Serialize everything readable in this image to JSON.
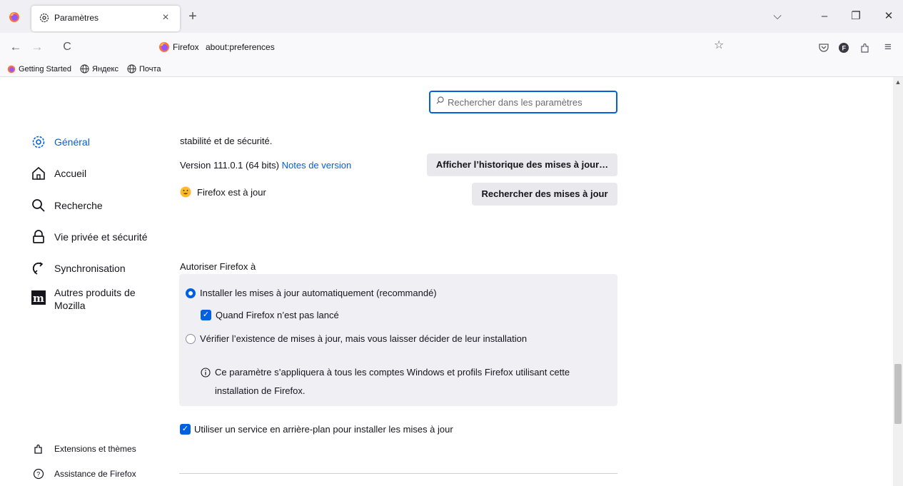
{
  "tab": {
    "title": "Paramètres",
    "close": "×",
    "new": "+"
  },
  "window": {
    "list_tabs": "⌵",
    "minimize": "–",
    "restore": "❐",
    "close": "✕"
  },
  "nav": {
    "back": "←",
    "forward": "→",
    "reload": "C"
  },
  "url": {
    "identity": "Firefox",
    "address": "about:preferences"
  },
  "bookmarks": [
    {
      "label": "Getting Started"
    },
    {
      "label": "Яндекс"
    },
    {
      "label": "Почта"
    }
  ],
  "search": {
    "placeholder": "Rechercher dans les paramètres"
  },
  "sidebar": {
    "items": [
      {
        "label": "Général"
      },
      {
        "label": "Accueil"
      },
      {
        "label": "Recherche"
      },
      {
        "label": "Vie privée et sécurité"
      },
      {
        "label": "Synchronisation"
      },
      {
        "label": "Autres produits de Mozilla"
      }
    ],
    "footer": [
      {
        "label": "Extensions et thèmes"
      },
      {
        "label": "Assistance de Firefox"
      }
    ]
  },
  "updates": {
    "truncated_text": "stabilité et de sécurité.",
    "version": "Version 111.0.1 (64 bits)",
    "release_notes": "Notes de version",
    "status": "Firefox est à jour",
    "history_button": "Afficher l’historique des mises à jour…",
    "check_button": "Rechercher des mises à jour",
    "allow_label": "Autoriser Firefox à",
    "auto_install": "Installer les mises à jour automatiquement (recommandé)",
    "when_not_running": "Quand Firefox n’est pas lancé",
    "manual": "Vérifier l’existence de mises à jour, mais vous laisser décider de leur installation",
    "info_line1": "Ce paramètre s’appliquera à tous les comptes Windows et profils Firefox utilisant cette",
    "info_line2": "installation de Firefox.",
    "background_service": "Utiliser un service en arrière-plan pour installer les mises à jour"
  },
  "colors": {
    "accent": "#0061e0",
    "tabstrip": "#f0f0f4",
    "box": "#f0f0f4",
    "button": "#e9e9ed"
  }
}
